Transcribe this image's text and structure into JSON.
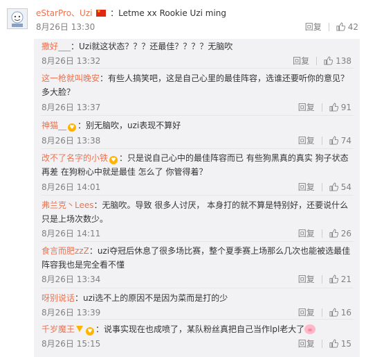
{
  "main_comment": {
    "user": "eStarPro、Uzi",
    "text": "：Letme  xx Rookie Uzi ming",
    "date": "8月26日 13:30",
    "reply_label": "回复",
    "likes": "42"
  },
  "replies": [
    {
      "user": "撒好___",
      "text": "：Uzi就这状态？？？还最佳？？？？无脑吹",
      "date": "8月26日 13:32",
      "reply_label": "回复",
      "likes": "138"
    },
    {
      "user": "这一枪就叫晚安",
      "text": "：有些人搞笑吧，这是自己心里的最佳阵容，选谁还要听你的意见？",
      "text2": "多大脸？",
      "date": "8月26日 13:37",
      "reply_label": "回复",
      "likes": "91"
    },
    {
      "user": "神猫__",
      "text": "：别无脑吹，uzi表现不算好",
      "date": "8月26日 13:38",
      "reply_label": "回复",
      "likes": "74"
    },
    {
      "user": "改不了名字的小铁",
      "text": "：只是说自己心中的最佳阵容而已 有些狗黑真的真实 狗子状态",
      "text2": "再差 在狗粉心中就是最佳 怎么了 你管得着？",
      "date": "8月26日 14:01",
      "reply_label": "回复",
      "likes": "54"
    },
    {
      "user": "弗兰克丶Lees",
      "text": "：无脑吹。导致 很多人讨厌，  本身打的就不算是特别好，还要说什么",
      "text2": "只是上场次数少。",
      "date": "8月26日 14:11",
      "reply_label": "回复",
      "likes": "26"
    },
    {
      "user": "食言而肥zzZ",
      "text": "：uzi夺冠后休息了很多场比赛，整个夏季赛上场那么几次也能被选最佳",
      "text2": "阵容我也是完全看不懂",
      "date": "8月26日 13:34",
      "reply_label": "回复",
      "likes": "21"
    },
    {
      "user": "呀别说话",
      "text": "：uzi选不上的原因不是因为菜而是打的少",
      "date": "8月26日 13:39",
      "reply_label": "回复",
      "likes": "16"
    },
    {
      "user": "千岁魔王",
      "text": "：说事实现在也成喷了，某队粉丝真把自己当作lpl老大了",
      "date": "8月26日 15:15",
      "reply_label": "回复",
      "likes": "15"
    }
  ],
  "icons": {
    "like": "thumbs-up-icon",
    "avatar": "avatar-icon",
    "flag": "china-flag-icon",
    "badge": "fan-badge-icon",
    "emoji_pig": "pig-emoji-icon"
  },
  "colors": {
    "username": "#eb7350",
    "meta": "#808080",
    "reply_bg": "#f2f2f5"
  }
}
